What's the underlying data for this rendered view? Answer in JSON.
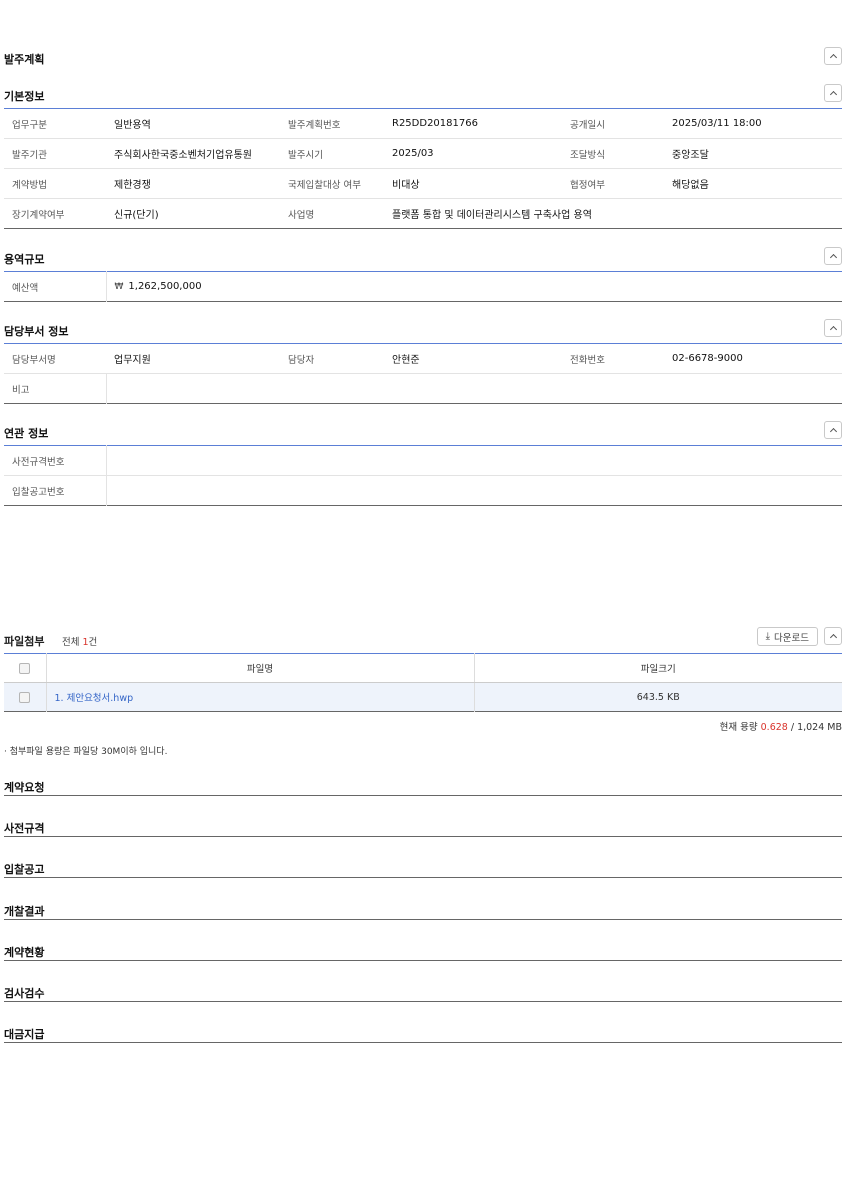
{
  "order_plan": {
    "title": "발주계획"
  },
  "basic": {
    "title": "기본정보",
    "rows": [
      [
        {
          "l": "업무구분",
          "v": "일반용역"
        },
        {
          "l": "발주계획번호",
          "v": "R25DD20181766"
        },
        {
          "l": "공개일시",
          "v": "2025/03/11 18:00"
        }
      ],
      [
        {
          "l": "발주기관",
          "v": "주식회사한국중소벤처기업유통원"
        },
        {
          "l": "발주시기",
          "v": "2025/03"
        },
        {
          "l": "조달방식",
          "v": "중앙조달"
        }
      ],
      [
        {
          "l": "계약방법",
          "v": "제한경쟁"
        },
        {
          "l": "국제입찰대상 여부",
          "v": "비대상"
        },
        {
          "l": "협정여부",
          "v": "해당없음"
        }
      ],
      [
        {
          "l": "장기계약여부",
          "v": "신규(단기)"
        },
        {
          "l": "사업명",
          "v": "플랫폼 통합 및 데이터관리시스템 구축사업 용역"
        }
      ]
    ]
  },
  "scale": {
    "title": "용역규모",
    "budget_label": "예산액",
    "currency": "₩",
    "budget_value": "1,262,500,000"
  },
  "dept": {
    "title": "담당부서 정보",
    "dept_label": "담당부서명",
    "dept_value": "업무지원",
    "person_label": "담당자",
    "person_value": "안현준",
    "phone_label": "전화번호",
    "phone_value": "02-6678-9000",
    "remark_label": "비고",
    "remark_value": ""
  },
  "related": {
    "title": "연관 정보",
    "pre_spec_label": "사전규격번호",
    "pre_spec_value": "",
    "bid_label": "입찰공고번호",
    "bid_value": ""
  },
  "files": {
    "title": "파일첨부",
    "count_prefix": "전체 ",
    "count": "1",
    "count_suffix": "건",
    "download_label": "다운로드",
    "col_name": "파일명",
    "col_size": "파일크기",
    "items": [
      {
        "name": "1. 제안요청서.hwp",
        "size": "643.5 KB"
      }
    ],
    "usage_prefix": "현재 용량 ",
    "usage_current": "0.628",
    "usage_suffix": " / 1,024 MB",
    "note": "· 첨부파일 용량은 파일당 30M이하 입니다."
  },
  "sections": [
    "계약요청",
    "사전규격",
    "입찰공고",
    "개찰결과",
    "계약현황",
    "검사검수",
    "대금지급"
  ]
}
